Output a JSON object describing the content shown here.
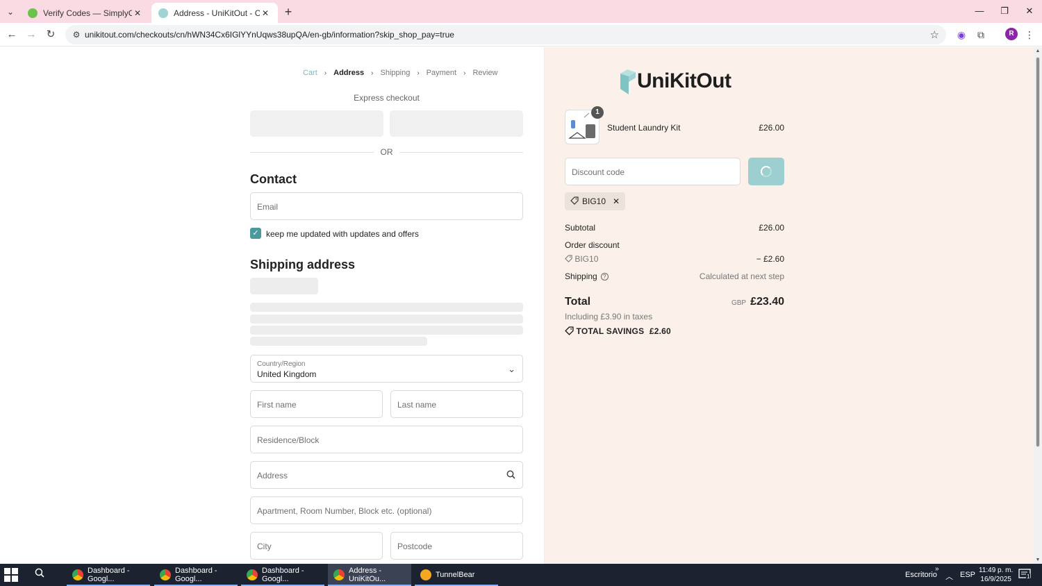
{
  "browser": {
    "tabs": [
      {
        "title": "Verify Codes — SimplyCodes",
        "active": false
      },
      {
        "title": "Address - UniKitOut - Checkout",
        "active": true
      }
    ],
    "url": "unikitout.com/checkouts/cn/hWN34Cx6IGlYYnUqws38upQA/en-gb/information?skip_shop_pay=true",
    "avatar_letter": "R"
  },
  "checkout": {
    "breadcrumbs": [
      "Cart",
      "Address",
      "Shipping",
      "Payment",
      "Review"
    ],
    "express_label": "Express checkout",
    "or_label": "OR",
    "contact_heading": "Contact",
    "email_placeholder": "Email",
    "newsletter_label": "keep me updated with updates and offers",
    "shipping_heading": "Shipping address",
    "country_label": "Country/Region",
    "country_value": "United Kingdom",
    "first_name_placeholder": "First name",
    "last_name_placeholder": "Last name",
    "residence_placeholder": "Residence/Block",
    "address_placeholder": "Address",
    "apartment_placeholder": "Apartment, Room Number, Block etc. (optional)",
    "city_placeholder": "City",
    "postcode_placeholder": "Postcode"
  },
  "summary": {
    "logo_text": "UniKitOut",
    "item": {
      "name": "Student Laundry Kit",
      "price": "£26.00",
      "quantity": "1"
    },
    "discount_placeholder": "Discount code",
    "applied_code": "BIG10",
    "subtotal_label": "Subtotal",
    "subtotal_value": "£26.00",
    "order_discount_label": "Order discount",
    "discount_code": "BIG10",
    "discount_value": "− £2.60",
    "shipping_label": "Shipping",
    "shipping_value": "Calculated at next step",
    "total_label": "Total",
    "currency": "GBP",
    "total_value": "£23.40",
    "taxes_note": "Including £3.90 in taxes",
    "savings_label": "TOTAL SAVINGS",
    "savings_value": "£2.60"
  },
  "taskbar": {
    "items": [
      "Dashboard - Googl...",
      "Dashboard - Googl...",
      "Dashboard - Googl...",
      "Address - UniKitOu...",
      "TunnelBear"
    ],
    "desktop_label": "Escritorio",
    "language": "ESP",
    "time": "11:49 p. m.",
    "date": "16/9/2025",
    "notification_count": "1"
  },
  "colors": {
    "tabbar_bg": "#fadbe3",
    "accent_teal": "#4a9a9d",
    "apply_button": "#9ecfd0",
    "summary_bg": "#fbf1ea"
  }
}
